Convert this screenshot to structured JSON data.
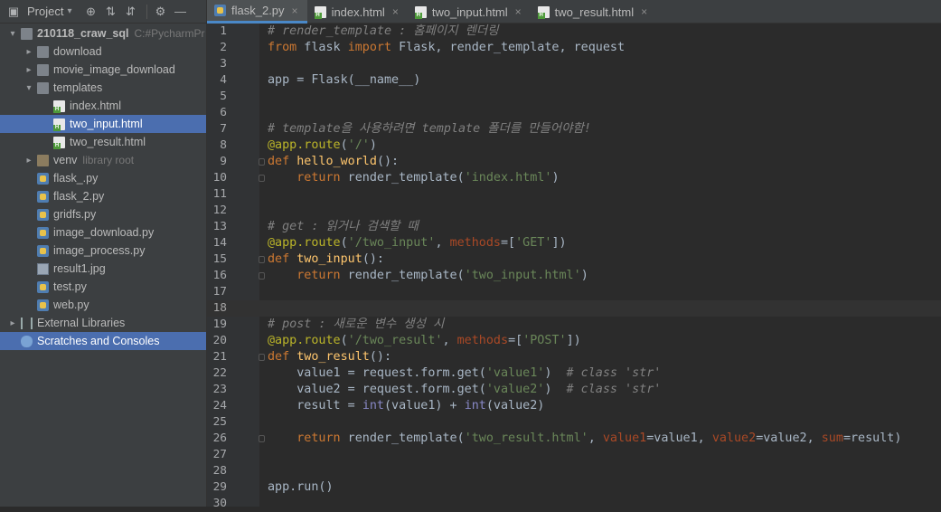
{
  "project": {
    "header_label": "Project",
    "tree": [
      {
        "label": "210118_craw_sql",
        "hint": "C:#PycharmPr",
        "type": "folder",
        "depth": 0,
        "chev": "▾",
        "bold": true
      },
      {
        "label": "download",
        "type": "folder",
        "depth": 1,
        "chev": "▸"
      },
      {
        "label": "movie_image_download",
        "type": "folder",
        "depth": 1,
        "chev": "▸"
      },
      {
        "label": "templates",
        "type": "folder",
        "depth": 1,
        "chev": "▾"
      },
      {
        "label": "index.html",
        "type": "html",
        "depth": 2,
        "chev": ""
      },
      {
        "label": "two_input.html",
        "type": "html",
        "depth": 2,
        "chev": "",
        "selected": true
      },
      {
        "label": "two_result.html",
        "type": "html",
        "depth": 2,
        "chev": ""
      },
      {
        "label": "venv",
        "hint": "library root",
        "type": "venv",
        "depth": 1,
        "chev": "▸"
      },
      {
        "label": "flask_.py",
        "type": "py",
        "depth": 1,
        "chev": ""
      },
      {
        "label": "flask_2.py",
        "type": "py",
        "depth": 1,
        "chev": ""
      },
      {
        "label": "gridfs.py",
        "type": "py",
        "depth": 1,
        "chev": ""
      },
      {
        "label": "image_download.py",
        "type": "py",
        "depth": 1,
        "chev": ""
      },
      {
        "label": "image_process.py",
        "type": "py",
        "depth": 1,
        "chev": ""
      },
      {
        "label": "result1.jpg",
        "type": "jpg",
        "depth": 1,
        "chev": ""
      },
      {
        "label": "test.py",
        "type": "py",
        "depth": 1,
        "chev": ""
      },
      {
        "label": "web.py",
        "type": "py",
        "depth": 1,
        "chev": ""
      },
      {
        "label": "External Libraries",
        "type": "lib",
        "depth": 0,
        "chev": "▸"
      },
      {
        "label": "Scratches and Consoles",
        "type": "scr",
        "depth": 0,
        "chev": "",
        "scratch": true
      }
    ]
  },
  "tabs": [
    {
      "label": "flask_2.py",
      "type": "py",
      "active": true
    },
    {
      "label": "index.html",
      "type": "html"
    },
    {
      "label": "two_input.html",
      "type": "html"
    },
    {
      "label": "two_result.html",
      "type": "html"
    }
  ],
  "tab_close_glyph": "×",
  "editor": {
    "current_line": 18,
    "lines": [
      [
        [
          "cm",
          "# render_template : 홈페이지 렌더링"
        ]
      ],
      [
        [
          "kw",
          "from"
        ],
        [
          "p",
          " flask "
        ],
        [
          "kw",
          "import"
        ],
        [
          "p",
          " Flask, render_template, request"
        ]
      ],
      [],
      [
        [
          "p",
          "app = Flask(__name__)"
        ]
      ],
      [],
      [],
      [
        [
          "cm",
          "# template을 사용하려면 template 폴더를 만들어야함!"
        ]
      ],
      [
        [
          "dec",
          "@app.route"
        ],
        [
          "p",
          "("
        ],
        [
          "str",
          "'/'"
        ],
        [
          "p",
          ")"
        ]
      ],
      [
        [
          "kw",
          "def"
        ],
        [
          "p",
          " "
        ],
        [
          "fn",
          "hello_world"
        ],
        [
          "p",
          "():"
        ]
      ],
      [
        [
          "p",
          "    "
        ],
        [
          "kw",
          "return"
        ],
        [
          "p",
          " render_template("
        ],
        [
          "str",
          "'index.html'"
        ],
        [
          "p",
          ")"
        ]
      ],
      [],
      [],
      [
        [
          "cm",
          "# get : 읽거나 검색할 때"
        ]
      ],
      [
        [
          "dec",
          "@app.route"
        ],
        [
          "p",
          "("
        ],
        [
          "str",
          "'/two_input'"
        ],
        [
          "p",
          ", "
        ],
        [
          "param",
          "methods"
        ],
        [
          "p",
          "=["
        ],
        [
          "str",
          "'GET'"
        ],
        [
          "p",
          "])"
        ]
      ],
      [
        [
          "kw",
          "def"
        ],
        [
          "p",
          " "
        ],
        [
          "fn",
          "two_input"
        ],
        [
          "p",
          "():"
        ]
      ],
      [
        [
          "p",
          "    "
        ],
        [
          "kw",
          "return"
        ],
        [
          "p",
          " render_template("
        ],
        [
          "str",
          "'two_input.html'"
        ],
        [
          "p",
          ")"
        ]
      ],
      [],
      [],
      [
        [
          "cm",
          "# post : 새로운 변수 생성 시"
        ]
      ],
      [
        [
          "dec",
          "@app.route"
        ],
        [
          "p",
          "("
        ],
        [
          "str",
          "'/two_result'"
        ],
        [
          "p",
          ", "
        ],
        [
          "param",
          "methods"
        ],
        [
          "p",
          "=["
        ],
        [
          "str",
          "'POST'"
        ],
        [
          "p",
          "])"
        ]
      ],
      [
        [
          "kw",
          "def"
        ],
        [
          "p",
          " "
        ],
        [
          "fn",
          "two_result"
        ],
        [
          "p",
          "():"
        ]
      ],
      [
        [
          "p",
          "    value1 = request.form.get("
        ],
        [
          "str",
          "'value1'"
        ],
        [
          "p",
          ")  "
        ],
        [
          "cm",
          "# class 'str'"
        ]
      ],
      [
        [
          "p",
          "    value2 = request.form.get("
        ],
        [
          "str",
          "'value2'"
        ],
        [
          "p",
          ")  "
        ],
        [
          "cm",
          "# class 'str'"
        ]
      ],
      [
        [
          "p",
          "    result = "
        ],
        [
          "bi",
          "int"
        ],
        [
          "p",
          "(value1) + "
        ],
        [
          "bi",
          "int"
        ],
        [
          "p",
          "(value2)"
        ]
      ],
      [],
      [
        [
          "p",
          "    "
        ],
        [
          "kw",
          "return"
        ],
        [
          "p",
          " render_template("
        ],
        [
          "str",
          "'two_result.html'"
        ],
        [
          "p",
          ", "
        ],
        [
          "param",
          "value1"
        ],
        [
          "p",
          "=value1, "
        ],
        [
          "param",
          "value2"
        ],
        [
          "p",
          "=value2, "
        ],
        [
          "param",
          "sum"
        ],
        [
          "p",
          "=result)"
        ]
      ],
      [],
      [],
      [
        [
          "p",
          "app.run()"
        ]
      ],
      []
    ]
  }
}
